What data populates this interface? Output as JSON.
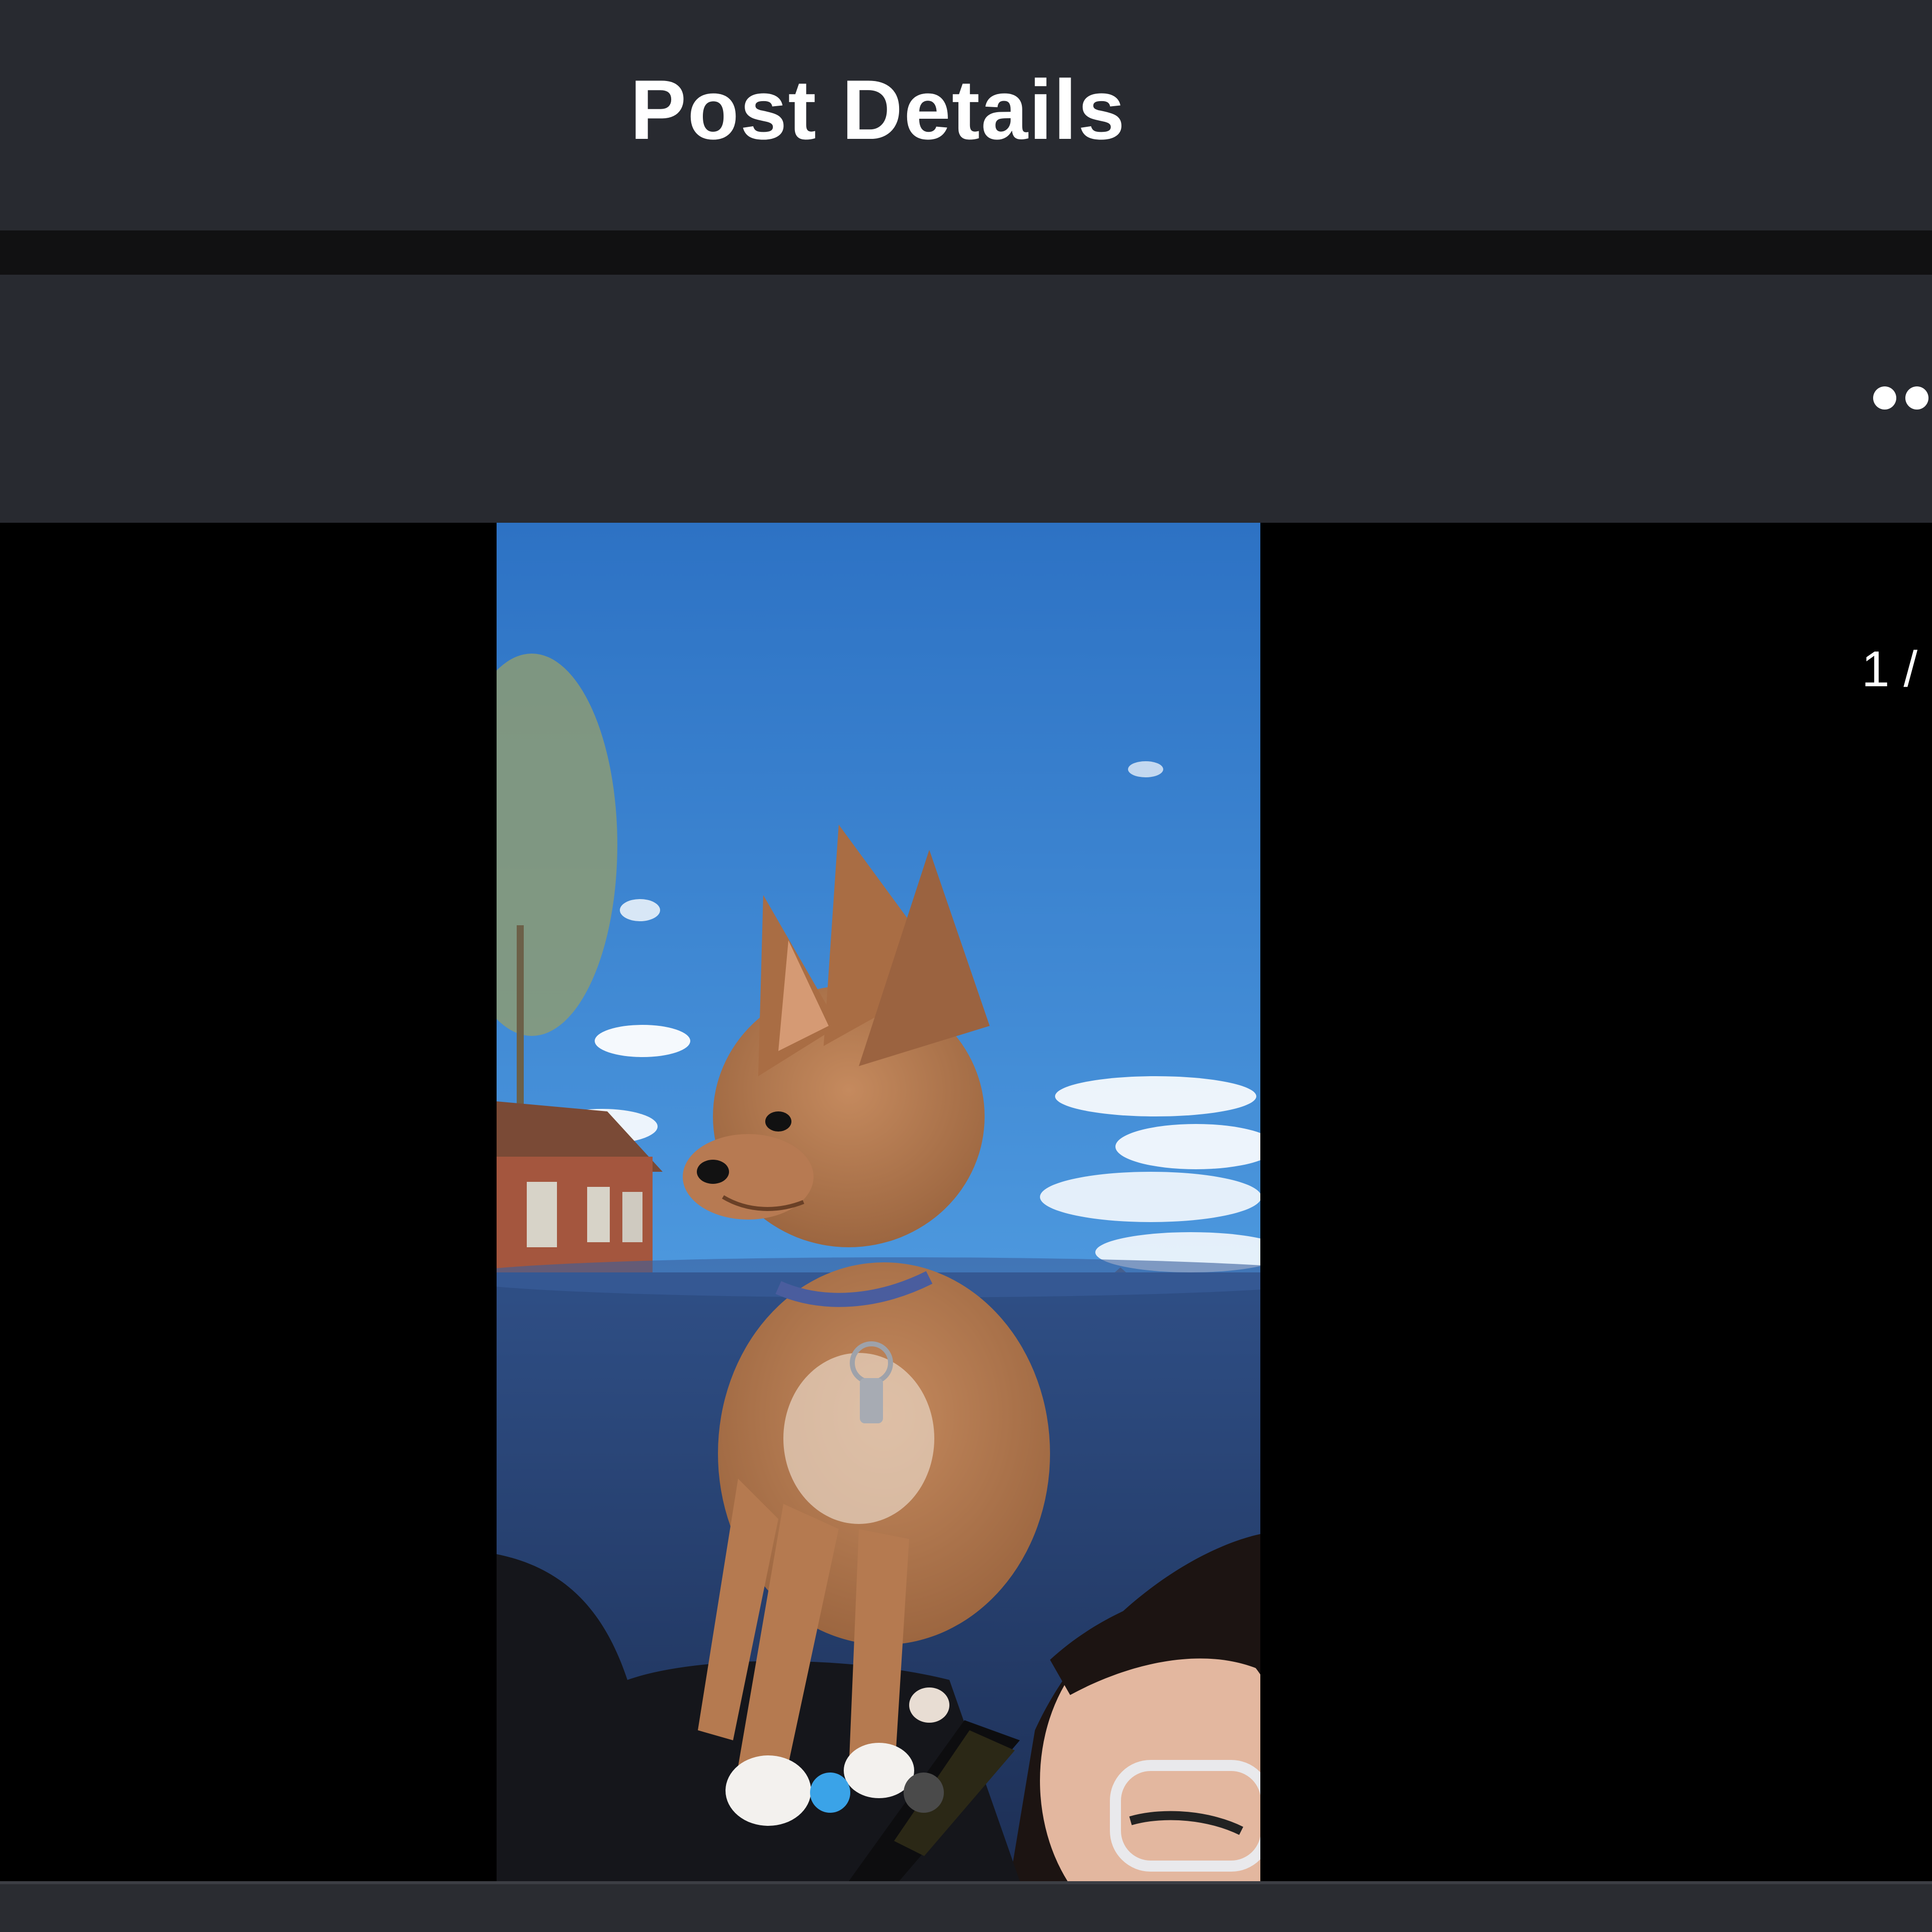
{
  "header": {
    "title": "Post Details"
  },
  "post": {
    "more_icon": "more-horizontal-icon",
    "photo_subject": "dog-with-person-photo"
  },
  "viewer": {
    "page_counter": "1 /",
    "current_slide": 1,
    "slides_visible": 2
  },
  "colors": {
    "header_bg": "#282a30",
    "divider_bg": "#111112",
    "viewer_bg": "#000000",
    "active_dot": "#3aa3e8",
    "inactive_dot": "#4a4a4a",
    "text": "#ffffff"
  }
}
